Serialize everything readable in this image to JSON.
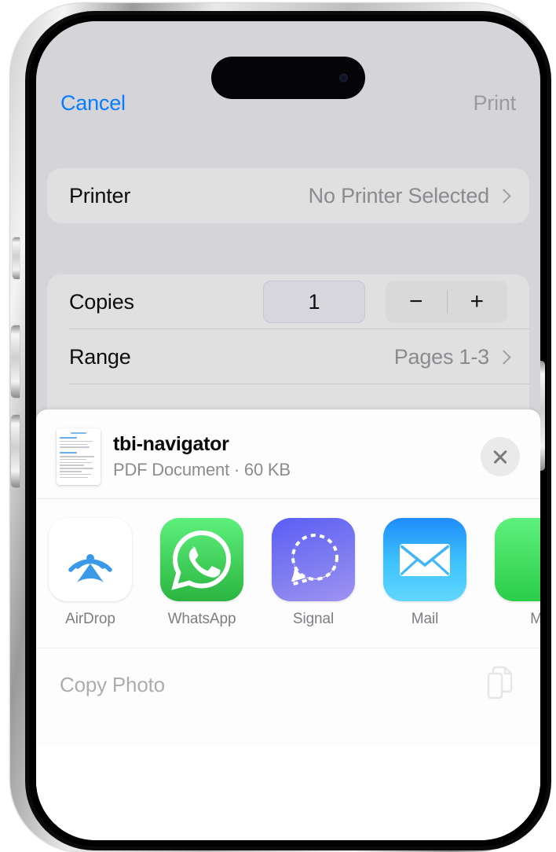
{
  "device": {
    "name": "iphone-15-pro",
    "dynamic_island": true
  },
  "print_dialog": {
    "cancel_label": "Cancel",
    "print_label": "Print",
    "printer_row": {
      "label": "Printer",
      "value": "No Printer Selected",
      "chevron": "chevron-right-icon"
    },
    "copies_row": {
      "label": "Copies",
      "value": "1",
      "minus_label": "−",
      "plus_label": "+"
    },
    "range_row": {
      "label": "Range",
      "value": "Pages 1-3",
      "chevron": "chevron-right-icon"
    }
  },
  "share_sheet": {
    "document": {
      "title": "tbi-navigator",
      "subtitle": "PDF Document · 60 KB",
      "thumbnail": "pdf-page-thumbnail"
    },
    "close_label": "close-icon",
    "apps": [
      {
        "label": "AirDrop",
        "icon": "airdrop-icon"
      },
      {
        "label": "WhatsApp",
        "icon": "whatsapp-icon"
      },
      {
        "label": "Signal",
        "icon": "signal-icon"
      },
      {
        "label": "Mail",
        "icon": "mail-icon"
      },
      {
        "label": "M",
        "icon": "messages-icon"
      }
    ],
    "actions": [
      {
        "label": "Copy Photo",
        "icon": "copy-documents-icon"
      }
    ]
  },
  "colors": {
    "accent_blue": "#0a7cff",
    "dialog_background": "#d4d4d9",
    "card_background": "#e0e0e0",
    "sheet_background": "#fdfdfd",
    "muted_text": "#8a8a8f",
    "whatsapp_green": "#2ab540",
    "signal_purple": "#5a5ef5",
    "mail_blue": "#1f8dfb",
    "messages_green": "#2bcd4a",
    "airdrop_blue": "#3a9ae8"
  }
}
